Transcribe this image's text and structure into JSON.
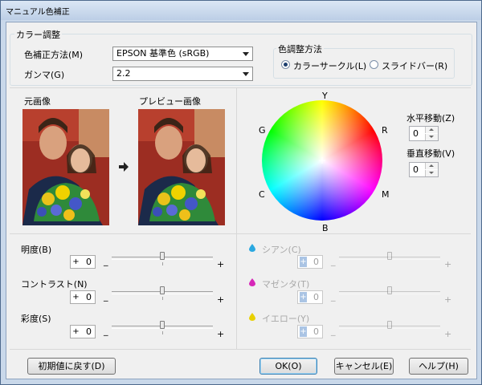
{
  "window_title": "マニュアル色補正",
  "color_adjust": {
    "group_label": "カラー調整",
    "method_label": "色補正方法(M)",
    "method_value": "EPSON 基準色 (sRGB)",
    "gamma_label": "ガンマ(G)",
    "gamma_value": "2.2",
    "mode_group_label": "色調整方法",
    "mode_options": [
      {
        "label": "カラーサークル(L)",
        "selected": true
      },
      {
        "label": "スライドバー(R)",
        "selected": false
      }
    ]
  },
  "preview": {
    "original_label": "元画像",
    "preview_label": "プレビュー画像",
    "arrow_icon": "arrow-right-icon"
  },
  "circle": {
    "labels": {
      "y": "Y",
      "r": "R",
      "m": "M",
      "b": "B",
      "c": "C",
      "g": "G"
    },
    "horizontal_label": "水平移動(Z)",
    "horizontal_value": "0",
    "vertical_label": "垂直移動(V)",
    "vertical_value": "0"
  },
  "sliders_left": [
    {
      "label": "明度(B)",
      "sign": "+",
      "value": "0",
      "min": "_",
      "max": "+"
    },
    {
      "label": "コントラスト(N)",
      "sign": "+",
      "value": "0",
      "min": "_",
      "max": "+"
    },
    {
      "label": "彩度(S)",
      "sign": "+",
      "value": "0",
      "min": "_",
      "max": "+"
    }
  ],
  "sliders_right": [
    {
      "label": "シアン(C)",
      "sign": "+",
      "value": "0",
      "min": "_",
      "max": "+",
      "color": "#2aa8e0"
    },
    {
      "label": "マゼンタ(T)",
      "sign": "+",
      "value": "0",
      "min": "_",
      "max": "+",
      "color": "#d628b8"
    },
    {
      "label": "イエロー(Y)",
      "sign": "+",
      "value": "0",
      "min": "_",
      "max": "+",
      "color": "#e8d000"
    }
  ],
  "buttons": {
    "reset": "初期値に戻す(D)",
    "ok": "OK(O)",
    "cancel": "キャンセル(E)",
    "help": "ヘルプ(H)"
  }
}
